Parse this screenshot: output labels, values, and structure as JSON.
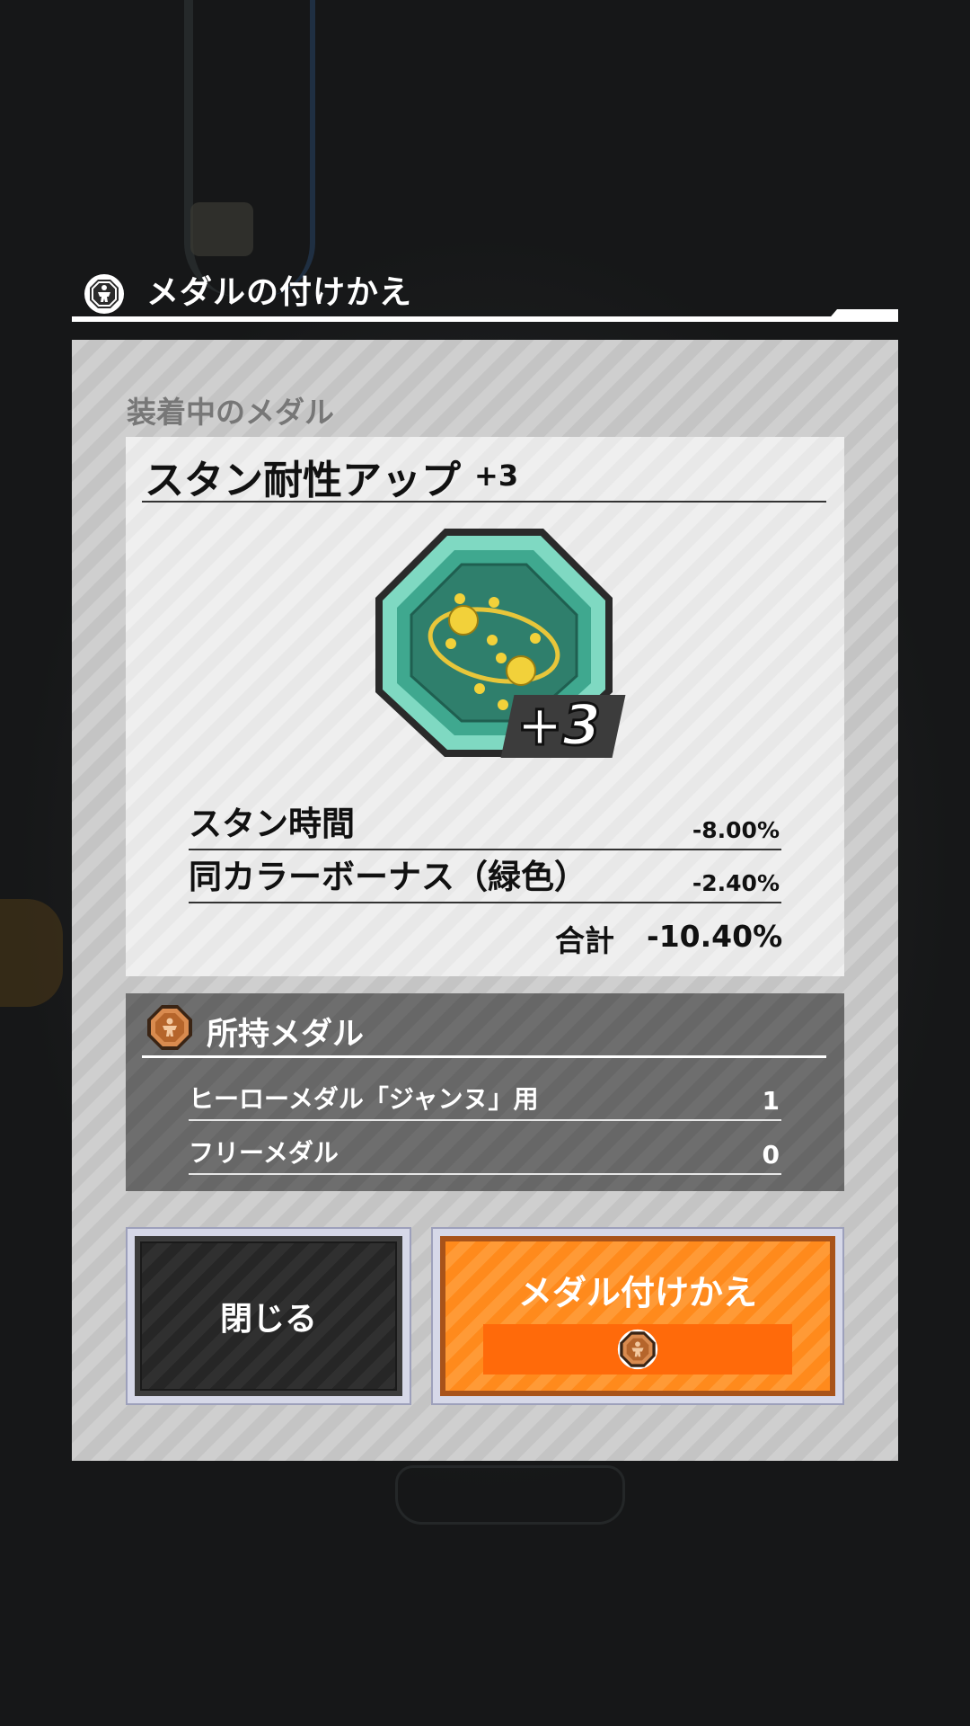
{
  "header": {
    "title": "メダルの付けかえ",
    "icon": "hero-medal-emblem-icon"
  },
  "equipped": {
    "section_label": "装着中のメダル",
    "medal_name": "スタン耐性アップ",
    "medal_level": "+3",
    "badge": "+3",
    "medal_icon": "stun-orbit-medal-icon",
    "stats": [
      {
        "label": "スタン時間",
        "value": "-8.00%"
      },
      {
        "label": "同カラーボーナス（緑色）",
        "value": "-2.40%"
      }
    ],
    "total_label": "合計",
    "total_value": "-10.40%"
  },
  "owned": {
    "title": "所持メダル",
    "icon": "bronze-hero-medal-icon",
    "rows": [
      {
        "label": "ヒーローメダル「ジャンヌ」用",
        "value": "1"
      },
      {
        "label": "フリーメダル",
        "value": "0"
      }
    ]
  },
  "buttons": {
    "close_label": "閉じる",
    "swap_label": "メダル付けかえ",
    "swap_cost_icon": "bronze-hero-medal-icon"
  },
  "colors": {
    "accent_orange": "#ff8a1c",
    "medal_green": "#3fa88f",
    "panel_gray": "#cfcfcf",
    "owned_gray": "#6e6e6e"
  }
}
